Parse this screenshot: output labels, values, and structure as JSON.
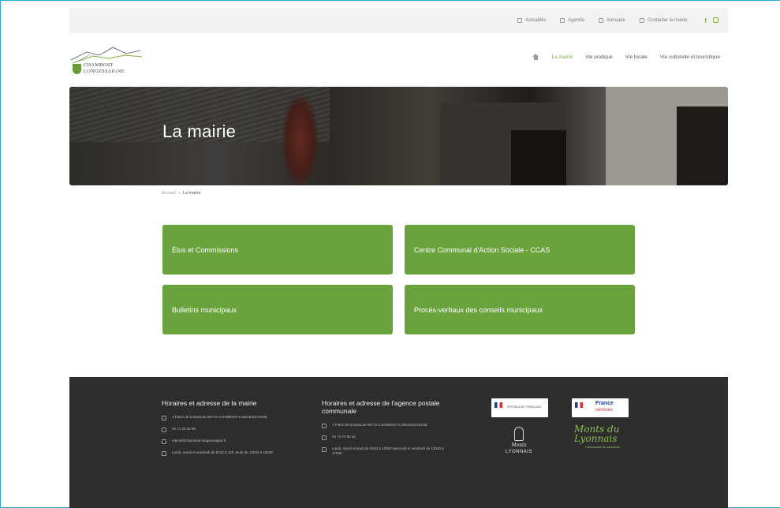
{
  "topbar": {
    "items": [
      {
        "label": "Actualités",
        "icon": "newspaper-icon"
      },
      {
        "label": "Agenda",
        "icon": "calendar-icon"
      },
      {
        "label": "Annuaire",
        "icon": "book-icon"
      },
      {
        "label": "Contacter la mairie",
        "icon": "mail-icon"
      }
    ],
    "social": {
      "facebook": "f"
    }
  },
  "header": {
    "logo_line1": "CHAMBOST",
    "logo_line2": "LONGESSAIGNE",
    "nav": [
      {
        "label": "La mairie",
        "active": true
      },
      {
        "label": "Vie pratique",
        "active": false
      },
      {
        "label": "Vie locale",
        "active": false
      },
      {
        "label": "Vie culturelle et touristique",
        "active": false
      }
    ]
  },
  "hero": {
    "title": "La mairie"
  },
  "breadcrumb": {
    "home": "Accueil",
    "separator": "»",
    "current": "La mairie"
  },
  "tiles": [
    {
      "label": "Élus et Commissions"
    },
    {
      "label": "Centre Communal d'Action Sociale - CCAS"
    },
    {
      "label": "Bulletins municipaux"
    },
    {
      "label": "Procès-verbaux des conseils municipaux"
    }
  ],
  "footer": {
    "col1": {
      "title": "Horaires et adresse de la mairie",
      "address": "1 Place de la Bascule 69770 CHAMBOST-LONGESSAIGNE",
      "phone": "04 74 26 32 88",
      "email": "mairie@chambost-longessaigne.fr",
      "hours": "Lundi, mardi et vendredi de 8h30 à 12h Jeudi de 13h30 à 18h30"
    },
    "col2": {
      "title": "Horaires et adresse de l'agence postale communale",
      "address": "1 Place de la Bascule 69770 CHAMBOST-LONGESSAIGNE",
      "phone": "04 74 70 82 52",
      "hours": "Lundi, mardi et jeudi de 8h30 à 12h00 Mercredi et vendredi de 13h30 à 17h00"
    },
    "partners": {
      "rf_label": "RÉPUBLIQUE FRANÇAISE",
      "fs_line1": "France",
      "fs_line2": "services",
      "monts_script": "Monts",
      "monts_caps": "LYONNAIS",
      "monts2_big1": "Monts du",
      "monts2_big2": "Lyonnais",
      "monts2_sub": "Communauté de communes"
    }
  },
  "colors": {
    "accent": "#6aa33d",
    "footer_bg": "#2d2d2d",
    "frame": "#29a9d6"
  }
}
